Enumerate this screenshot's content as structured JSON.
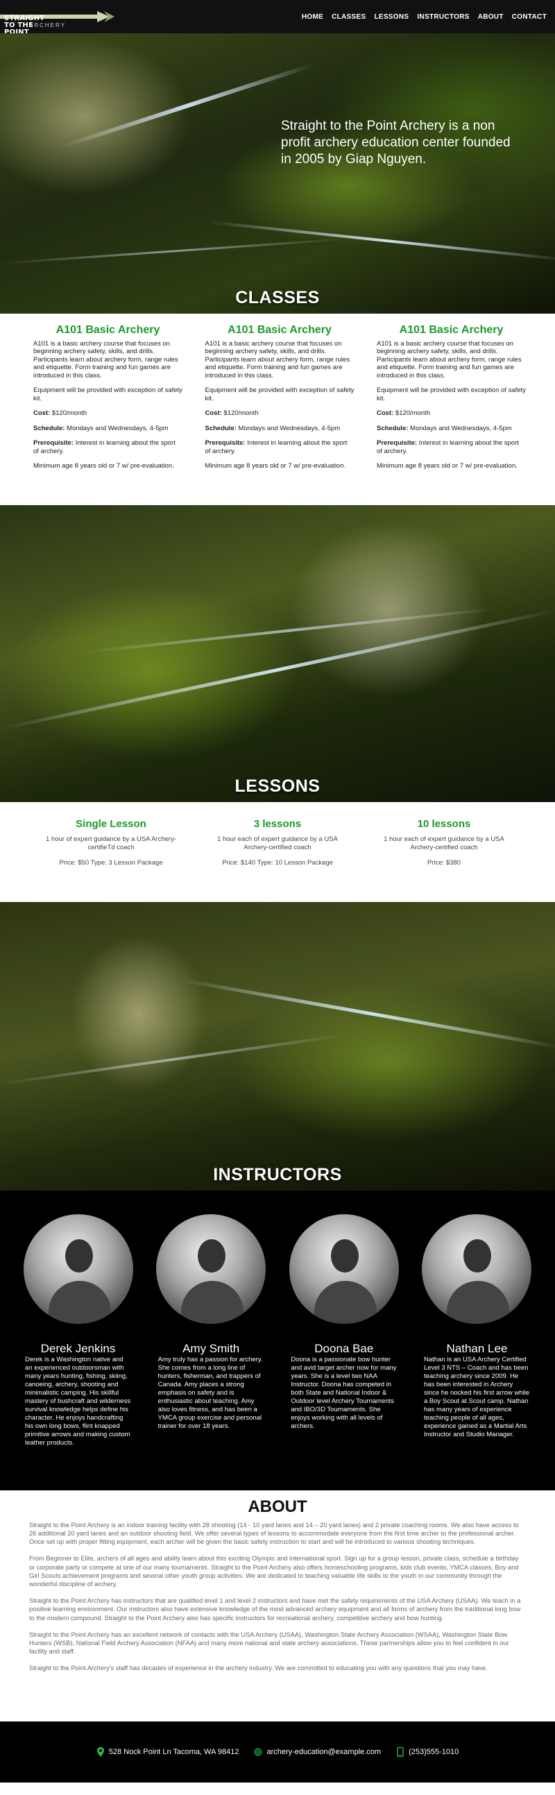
{
  "nav": {
    "logo_line1": "STRAIGHT TO THE POINT",
    "logo_line2": "ARCHERY",
    "items": [
      "HOME",
      "CLASSES",
      "LESSONS",
      "INSTRUCTORS",
      "ABOUT",
      "CONTACT"
    ]
  },
  "hero": {
    "tagline": "Straight to the Point Archery is a non profit archery education center founded in 2005 by Giap Nguyen.",
    "section_title": "CLASSES"
  },
  "classes": [
    {
      "title": "A101 Basic Archery",
      "description": "A101 is a basic archery course that focuses on beginning archery safety, skills, and drills. Participants learn about archery form, range rules and etiquette. Form training and fun games are introduced in this class.",
      "equipment": "Equipment will be provided with exception of safety kit.",
      "cost_label": "Cost:",
      "cost_value": " $120/month",
      "schedule_label": "Schedule:",
      "schedule_value": " Mondays and Wednesdays, 4-5pm",
      "prereq_label": "Prerequisite:",
      "prereq_value": " Interest in learning about the sport of archery.",
      "age": "Minimum age 8 years old or 7 w/ pre-evaluation."
    },
    {
      "title": "A101 Basic Archery",
      "description": "A101 is a basic archery course that focuses on beginning archery safety, skills, and drills. Participants learn about archery form, range rules and etiquette. Form training and fun games are introduced in this class.",
      "equipment": "Equipment will be provided with exception of safety kit.",
      "cost_label": "Cost:",
      "cost_value": " $120/month",
      "schedule_label": "Schedule:",
      "schedule_value": " Mondays and Wednesdays, 4-5pm",
      "prereq_label": "Prerequisite:",
      "prereq_value": " Interest in learning about the sport of archery.",
      "age": "Minimum age 8 years old or 7 w/ pre-evaluation."
    },
    {
      "title": "A101 Basic Archery",
      "description": "A101 is a basic archery course that focuses on beginning archery safety, skills, and drills. Participants learn about archery form, range rules and etiquette. Form training and fun games are introduced in this class.",
      "equipment": "Equipment will be provided with exception of safety kit.",
      "cost_label": "Cost:",
      "cost_value": " $120/month",
      "schedule_label": "Schedule:",
      "schedule_value": " Mondays and Wednesdays, 4-5pm",
      "prereq_label": "Prerequisite:",
      "prereq_value": " Interest in learning about the sport of archery.",
      "age": "Minimum age 8 years old or 7 w/ pre-evaluation."
    }
  ],
  "lessons_banner": {
    "section_title": "LESSONS"
  },
  "lessons": [
    {
      "title": "Single Lesson",
      "description": "1 hour of expert guidance by a USA Archery-certifieTd coach",
      "price": "Price: $50 Type: 3 Lesson Package"
    },
    {
      "title": "3 lessons",
      "description": "1 hour each of expert guidance by a USA Archery-certified coach",
      "price": "Price: $140 Type: 10 Lesson Package"
    },
    {
      "title": "10 lessons",
      "description": "1 hour each of expert guidance by a USA Archery-certified coach",
      "price": "Price: $380"
    }
  ],
  "instructors_banner": {
    "section_title": "INSTRUCTORS"
  },
  "instructors": [
    {
      "name": "Derek Jenkins",
      "bio": "Derek is a Washington native and an experienced outdoorsman with many years hunting, fishing, skiing, canoeing, archery, shooting and minimalistic camping. His skillful mastery of bushcraft and wilderness survival knowledge helps define his character. He enjoys handcrafting his own long bows, flint knapped primitive arrows and making custom leather products."
    },
    {
      "name": "Amy Smith",
      "bio": "Amy truly has a passion for archery. She comes from a long line of hunters, fisherman, and trappers of Canada. Amy places a strong emphasis on safety and is enthusiastic about teaching. Amy also loves fitness, and has been a YMCA group exercise and personal trainer for over 18 years."
    },
    {
      "name": "Doona Bae",
      "bio": "Doona is a passionate bow hunter and avid target archer now for many years. She is a level two NAA Instructor. Doona has competed in both State and National Indoor & Outdoor level Archery Tournaments and IBO/3D Tournaments. She enjoys working with all levels of archers."
    },
    {
      "name": "Nathan Lee",
      "bio": "Nathan is an USA Archery Certified Level 3 NTS – Coach and has been teaching archery since 2009. He has been interested in Archery since he nocked his first arrow while a Boy Scout at Scout camp. Nathan has many years of experience teaching people of all ages, experience gained as a Martial Arts Instructor and Studio Manager."
    }
  ],
  "about": {
    "title": "ABOUT",
    "paragraphs": [
      "Straight to the Point Archery is an indoor training facility with 28 shooting (14 - 10 yard lanes and 14 – 20 yard lanes) and 2 private coaching rooms. We also have access to 26 additional 20 yard lanes and an outdoor shooting field. We offer several types of lessons to accommodate everyone from the first time archer to the professional archer. Once set up with proper fitting equipment, each archer will be given the basic safety instruction to start and will be introduced to various shooting techniques.",
      "From Beginner to Elite, archers of all ages and ability learn about this exciting Olympic and international sport. Sign up for a group lesson, private class, schedule a birthday or corporate party or compete at one of our many tournaments. Straight to the Point Archery also offers homeschooling programs, kids club events, YMCA classes, Boy and Girl Scouts achievement programs and several other youth group activities. We are dedicated to teaching valuable life skills to the youth in our community through the wonderful discipline of archery.",
      "Straight to the Point Archery has instructors that are qualified level 1 and level 2 instructors and have met the safety requirements of the USA Archery (USAA). We teach in a positive learning environment. Our instructors also have extensive knowledge of the most advanced archery equipment and all forms of archery from the traditional long bow to the modern compound. Straight to the Point Archery also has specific instructors for recreational archery, competitive archery and bow hunting.",
      "Straight to the Point Archery has an excellent network of contacts with the USA Archery (USAA), Washington State Archery Association (WSAA), Washington State Bow Hunters (WSB), National Field Archery Association (NFAA) and many more national and state archery associations. These partnerships allow you to feel confident in our facility and staff.",
      "Straight to the Point Archery's staff has decades of experience in the archery industry. We are committed to educating you with any questions that you may have."
    ]
  },
  "footer": {
    "address": "528 Nock Point Ln Tacoma, WA 98412",
    "email": "archery-education@example.com",
    "phone": "(253)555-1010",
    "accent_color": "#2db84a"
  }
}
